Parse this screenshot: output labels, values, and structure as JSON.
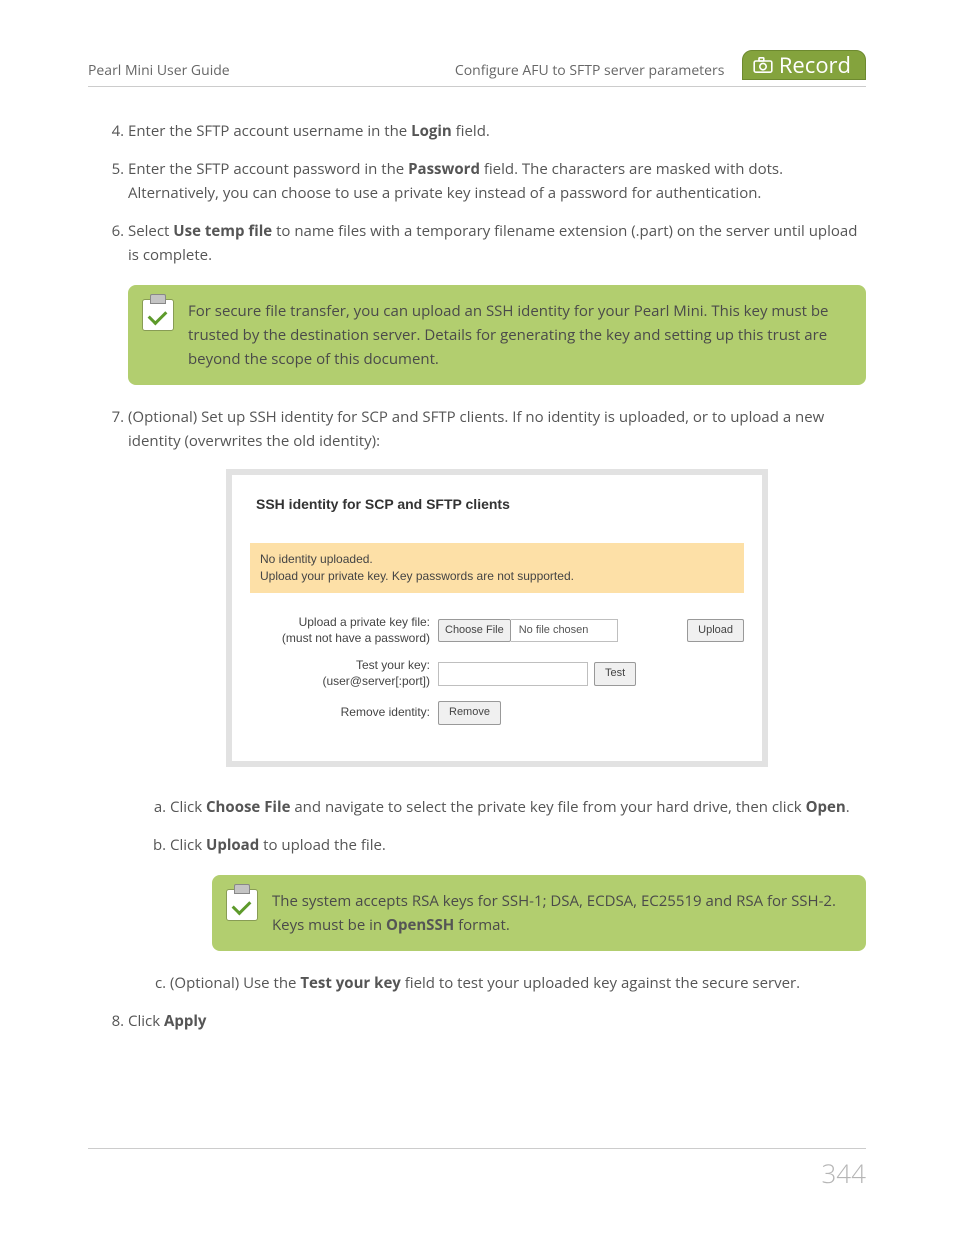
{
  "header": {
    "guide_title": "Pearl Mini User Guide",
    "section_title": "Configure AFU to SFTP server parameters",
    "record_label": "Record"
  },
  "steps": {
    "s4_pre": "Enter the SFTP account username in the ",
    "s4_bold": "Login",
    "s4_post": " field.",
    "s5_pre": "Enter the SFTP account password in the ",
    "s5_bold": "Password",
    "s5_post": " field. The characters are masked with dots. Alternatively, you can choose to use a private key instead of a password for authentication.",
    "s6_pre": "Select ",
    "s6_bold": "Use temp file",
    "s6_post": " to name files with a temporary filename extension (.part) on the server until upload is complete.",
    "s7": "(Optional) Set up SSH identity for SCP and SFTP clients. If no identity is uploaded, or to upload a new identity (overwrites the old identity):",
    "s8_pre": "Click ",
    "s8_bold": "Apply"
  },
  "callout1": "For secure file transfer, you can upload an SSH identity for your Pearl Mini. This key must be trusted by the destination server. Details for generating the key and setting up this trust are beyond the scope of this document.",
  "ssh_panel": {
    "title": "SSH identity for SCP and SFTP clients",
    "warn_line1": "No identity uploaded.",
    "warn_line2": "Upload your private key. Key passwords are not supported.",
    "row1_label_l1": "Upload a private key file:",
    "row1_label_l2": "(must not have a password)",
    "choose_btn": "Choose File",
    "no_file": "No file chosen",
    "upload_btn": "Upload",
    "row2_label_l1": "Test your key:",
    "row2_label_l2": "(user@server[:port])",
    "test_btn": "Test",
    "row3_label": "Remove identity:",
    "remove_btn": "Remove"
  },
  "substeps": {
    "a_pre": "Click ",
    "a_bold1": "Choose File",
    "a_mid": " and navigate to select the private key file from your hard drive, then click ",
    "a_bold2": "Open",
    "a_post": ".",
    "b_pre": "Click ",
    "b_bold": "Upload",
    "b_post": " to upload the file.",
    "c_pre": "(Optional) Use the ",
    "c_bold": "Test your key",
    "c_post": " field to test your uploaded key against the secure server."
  },
  "callout2_pre": "The system accepts RSA keys for SSH-1; DSA, ECDSA, EC25519 and RSA for SSH-2. Keys must be in ",
  "callout2_bold": "OpenSSH",
  "callout2_post": " format.",
  "page_number": "344"
}
